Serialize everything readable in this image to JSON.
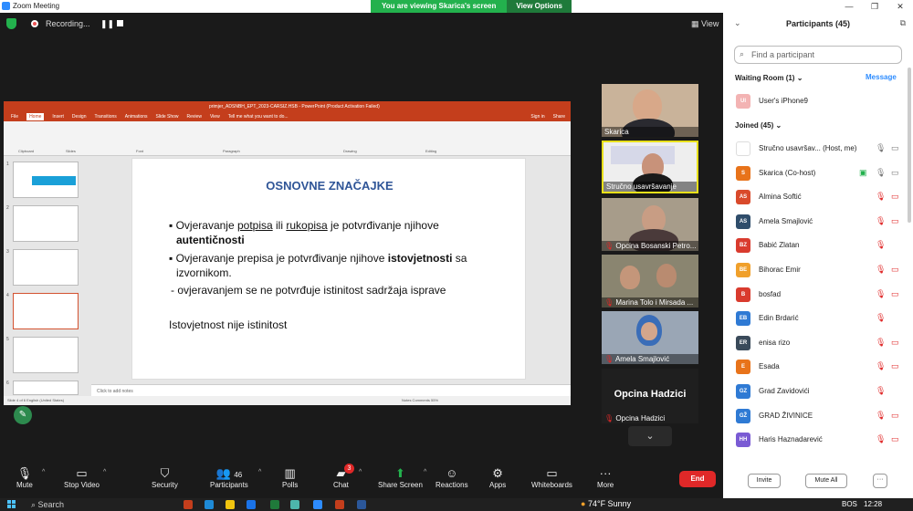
{
  "window": {
    "title": "Zoom Meeting",
    "controls": [
      "—",
      "❐",
      "✕"
    ]
  },
  "viewing": {
    "text": "You are viewing Skarica's screen",
    "options": "View Options"
  },
  "recording": {
    "label": "Recording..."
  },
  "view_label": "View",
  "ppt": {
    "title": "primjer_ADSNBH_EPT_2023-CARSIZ.HSB - PowerPoint (Product Activation Failed)",
    "menu": [
      "File",
      "Home",
      "Insert",
      "Design",
      "Transitions",
      "Animations",
      "Slide Show",
      "Review",
      "View",
      "Tell me what you want to do..."
    ],
    "signin": "Sign in",
    "share": "Share",
    "ribbon_groups": [
      "Clipboard",
      "Slides",
      "Font",
      "Paragraph",
      "Drawing",
      "Editing"
    ],
    "notes": "Click to add notes",
    "status_left": "Slide 4 of 6    English (United States)",
    "status_right": "Notes    Comments    55%"
  },
  "slide": {
    "title": "OSNOVNE ZNAČAJKE",
    "b1_pre": "Ovjeravanje ",
    "b1_u1": "potpisa",
    "b1_mid": " ili ",
    "b1_u2": "rukopisa",
    "b1_post": " je potvrđivanje njihove",
    "b1_bold": "autentičnosti",
    "b2_pre": "Ovjeravanje prepisa je potvrđivanje njihove ",
    "b2_bold": "istovjetnosti",
    "b2_post": " sa",
    "b2_line2": "izvornikom.",
    "b3": "- ovjeravanjem se ne potvrđuje istinitost sadržaja isprave",
    "b4": "Istovjetnost nije istinitost"
  },
  "tiles": [
    {
      "name": "Skarica",
      "mic": false
    },
    {
      "name": "Stručno usavršavanje",
      "mic": false
    },
    {
      "name": "Opcina Bosanski Petro...",
      "mic": true
    },
    {
      "name": "Marina Tolo i Mirsada ...",
      "mic": true
    },
    {
      "name": "Amela Smajlović",
      "mic": true
    },
    {
      "name": "Opcina Hadzici",
      "mic": true,
      "big": "Opcina Hadzici"
    }
  ],
  "panel": {
    "title": "Participants (45)",
    "search_placeholder": "Find a participant",
    "waiting_label": "Waiting Room (1)",
    "message": "Message",
    "waiting": [
      {
        "initials": "UI",
        "name": "User's iPhone9",
        "color": "#f3b3b3"
      }
    ],
    "joined_label": "Joined (45)",
    "joined": [
      {
        "initials": "",
        "name": "Stručno usavršav...  (Host, me)",
        "color": "#ffffff"
      },
      {
        "initials": "S",
        "name": "Skarica (Co-host)",
        "color": "#e8731a"
      },
      {
        "initials": "AS",
        "name": "Almina Softić",
        "color": "#d94a2b"
      },
      {
        "initials": "AS",
        "name": "Amela Smajlović",
        "color": "#2f4d6b"
      },
      {
        "initials": "BZ",
        "name": "Babić Zlatan",
        "color": "#d93b2e"
      },
      {
        "initials": "BE",
        "name": "Bihorac Emir",
        "color": "#f0a02b"
      },
      {
        "initials": "B",
        "name": "bosfad",
        "color": "#d93b2e"
      },
      {
        "initials": "EB",
        "name": "Edin Brdarić",
        "color": "#2f7ad4"
      },
      {
        "initials": "ER",
        "name": "enisa rizo",
        "color": "#3a4a5a"
      },
      {
        "initials": "E",
        "name": "Esada",
        "color": "#e8731a"
      },
      {
        "initials": "GZ",
        "name": "Grad Zavidovići",
        "color": "#2f7ad4"
      },
      {
        "initials": "GŽ",
        "name": "GRAD ŽIVINICE",
        "color": "#2f7ad4"
      },
      {
        "initials": "HH",
        "name": "Haris Haznadarević",
        "color": "#7a5bd4"
      }
    ],
    "invite": "Invite",
    "mute_all": "Mute All",
    "more": "···"
  },
  "toolbar": {
    "mute": "Mute",
    "stop_video": "Stop Video",
    "security": "Security",
    "participants": "Participants",
    "participants_count": "46",
    "polls": "Polls",
    "chat": "Chat",
    "chat_badge": "3",
    "share_screen": "Share Screen",
    "reactions": "Reactions",
    "apps": "Apps",
    "whiteboards": "Whiteboards",
    "more": "More",
    "end": "End"
  },
  "taskbar": {
    "search": "Search",
    "weather": "74°F  Sunny",
    "lang": "BOS",
    "time": "12:28"
  },
  "colors": {
    "zoom_blue": "#2d8cff",
    "green": "#23b14d",
    "red": "#e02828",
    "ppt": "#c43e1c"
  }
}
